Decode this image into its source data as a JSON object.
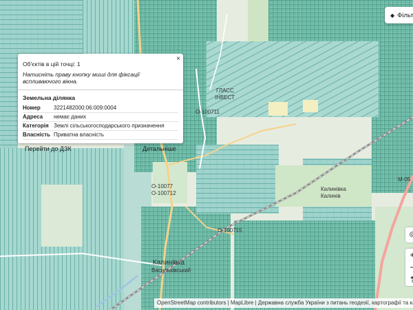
{
  "popup": {
    "close": "×",
    "count": "Об'єктів в цій точці: 1",
    "hint": "Натисніть праву кнопку миші для фіксації вспливаючого вікна.",
    "section": "Земельна ділянка",
    "rows": [
      {
        "key": "Номер",
        "value": "3221482000:06:009:0004"
      },
      {
        "key": "Адреса",
        "value": "немає даних"
      },
      {
        "key": "Категорія",
        "value": "Землі сільськогосподарського призначення"
      },
      {
        "key": "Власність",
        "value": "Приватна власність"
      }
    ],
    "btn_dzk": "Перейти до ДЗК",
    "btn_detail": "Детальніше"
  },
  "filter": {
    "label": "Фільт",
    "icon": "layers-icon"
  },
  "controls": {
    "target": "◎",
    "zoom_in": "+",
    "zoom_out": "−",
    "compass": "⇡"
  },
  "attribution": "OpenStreetMap contributors | MapLibre | Державна служба України з питань геодезії, картографії та кадастру",
  "map_labels": {
    "glass": "ГЛАСС",
    "invest": "ІНВЕСТ",
    "road1": "О-100711",
    "road2": "О-100712",
    "road3": "О-100715",
    "road4": "О-10077",
    "highway": "М-05",
    "village": "Калинівка",
    "district": "Васильківський",
    "town2": "Калинівка",
    "town2_sub": "Калинів"
  },
  "colors": {
    "parcel": "#9cd3cc",
    "parcel_edge": "#5fa9a0",
    "field": "#c9e3c3",
    "road": "#f6d28a",
    "rail": "#8f8f8f",
    "highway": "#f4a59c"
  }
}
